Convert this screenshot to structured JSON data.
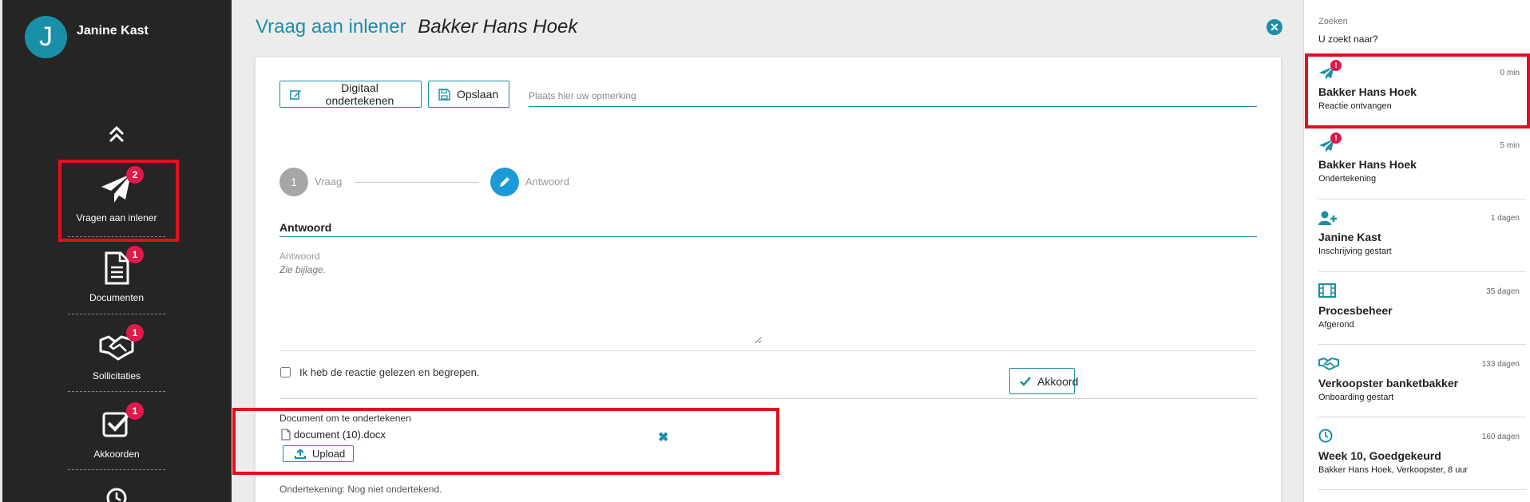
{
  "user": {
    "initial": "J",
    "name": "Janine Kast"
  },
  "sidebar": {
    "items": [
      {
        "label": "Vragen aan inlener",
        "badge": "2",
        "icon": "paper-plane-icon"
      },
      {
        "label": "Documenten",
        "badge": "1",
        "icon": "document-icon"
      },
      {
        "label": "Sollicitaties",
        "badge": "1",
        "icon": "handshake-icon"
      },
      {
        "label": "Akkoorden",
        "badge": "1",
        "icon": "checkbox-icon"
      }
    ]
  },
  "page": {
    "title": "Vraag aan inlener",
    "subtitle": "Bakker Hans Hoek",
    "toolbar": {
      "sign_label": "Digitaal ondertekenen",
      "save_label": "Opslaan",
      "remark_placeholder": "Plaats hier uw opmerking"
    },
    "steps": [
      {
        "number": "1",
        "label": "Vraag"
      },
      {
        "label": "Antwoord"
      }
    ],
    "section_title": "Antwoord",
    "answer_label": "Antwoord",
    "answer_value": "Zie bijlage.",
    "confirm_label": "Ik heb de reactie gelezen en begrepen.",
    "agree_label": "Akkoord",
    "document": {
      "title": "Document om te ondertekenen",
      "filename": "document (10).docx",
      "upload_label": "Upload"
    },
    "signature_label": "Ondertekening:",
    "signature_status": "Nog niet ondertekend."
  },
  "right_panel": {
    "search_label": "Zoeken",
    "search_placeholder": "U zoekt naar?",
    "items": [
      {
        "time": "0 min",
        "title": "Bakker Hans Hoek",
        "subtitle": "Reactie ontvangen",
        "icon": "paper-plane-alert-icon",
        "alert": "!"
      },
      {
        "time": "5 min",
        "title": "Bakker Hans Hoek",
        "subtitle": "Ondertekening",
        "icon": "paper-plane-alert-icon",
        "alert": "!"
      },
      {
        "time": "1 dagen",
        "title": "Janine Kast",
        "subtitle": "Inschrijving gestart",
        "icon": "user-plus-icon"
      },
      {
        "time": "35 dagen",
        "title": "Procesbeheer",
        "subtitle": "Afgerond",
        "icon": "film-icon"
      },
      {
        "time": "133 dagen",
        "title": "Verkoopster banketbakker",
        "subtitle": "Onboarding gestart",
        "icon": "handshake-icon"
      },
      {
        "time": "160 dagen",
        "title": "Week 10, Goedgekeurd",
        "subtitle": "Bakker Hans Hoek, Verkoopster, 8 uur",
        "icon": "clock-icon"
      }
    ]
  },
  "colors": {
    "accent": "#1a8fa8",
    "badge": "#e0194a",
    "sidebar_bg": "#252525",
    "highlight": "#e01020"
  }
}
